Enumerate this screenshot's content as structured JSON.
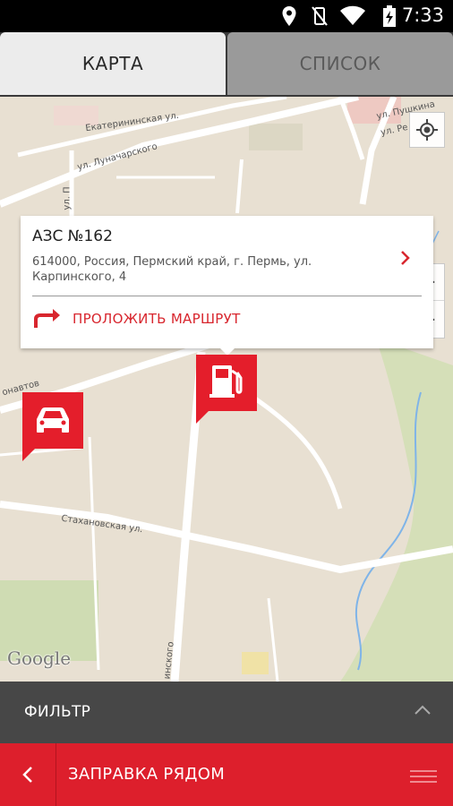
{
  "status_bar": {
    "time": "7:33",
    "icons": [
      "location-icon",
      "vibrate-off-icon",
      "wifi-icon",
      "battery-charging-icon"
    ]
  },
  "tabs": [
    {
      "label": "КАРТА",
      "active": true
    },
    {
      "label": "СПИСОК",
      "active": false
    }
  ],
  "map": {
    "streets": {
      "ekaterininskaya": "Екатерининская ул.",
      "lunacharskogo": "ул. Луначарского",
      "pushkina": "ул. Пушкина",
      "re": "ул. Ре",
      "p": "ул. П",
      "onavtov": "онавтов",
      "stakhanovskaya": "Стахановская ул.",
      "inskogo": "инского"
    },
    "attribution": "Google",
    "controls": {
      "zoom_out": "−",
      "zoom_in": "+"
    }
  },
  "popup": {
    "title": "АЗС №162",
    "address": "614000, Россия, Пермский край, г. Пермь, ул. Карпинского, 4",
    "route_label": "ПРОЛОЖИТЬ МАРШРУТ"
  },
  "filter": {
    "label": "ФИЛЬТР"
  },
  "bottom_bar": {
    "label": "ЗАПРАВКА РЯДОМ"
  },
  "colors": {
    "accent": "#dd1f2c",
    "marker": "#e41e2b",
    "map_bg": "#e8e0d2"
  }
}
